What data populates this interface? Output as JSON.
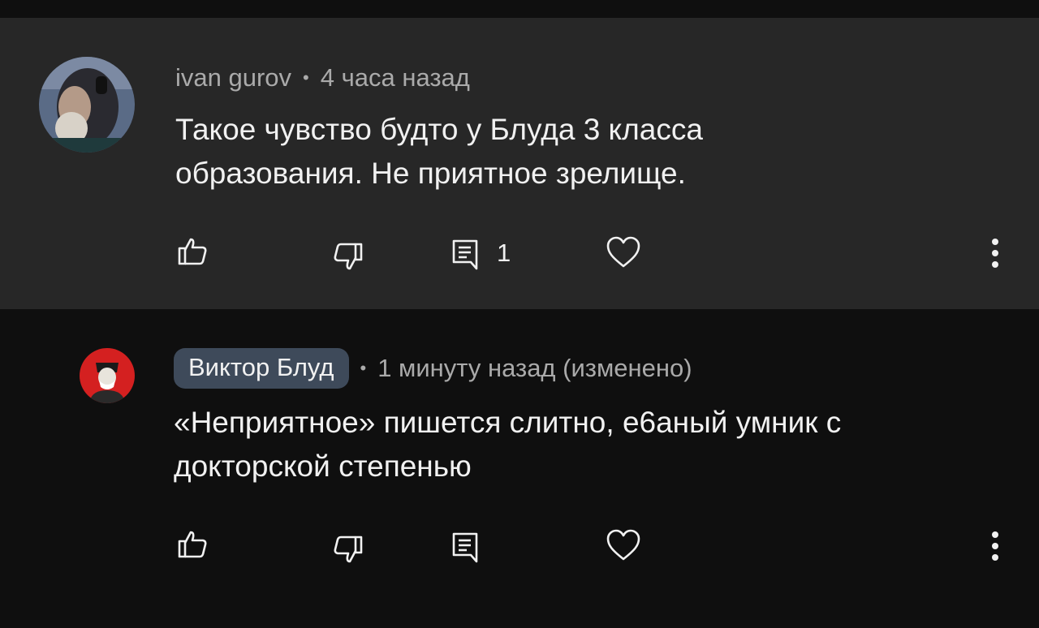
{
  "comments": [
    {
      "author": "ivan gurov",
      "time": "4 часа назад",
      "text_line1": "Такое чувство будто у Блуда 3 класса",
      "text_line2": "образования. Не приятное зрелище.",
      "reply_count": "1"
    },
    {
      "author": "Виктор Блуд",
      "time": "1 минуту назад (изменено)",
      "text_line1": "«Неприятное» пишется слитно, е6аный умник с",
      "text_line2": "докторской степенью"
    }
  ],
  "separator": "•",
  "icons": [
    "like-icon",
    "dislike-icon",
    "reply-icon",
    "heart-icon",
    "more-vertical-icon"
  ],
  "colors": {
    "background": "#0f0f0f",
    "highlighted_comment": "#272727",
    "author_badge": "#3e4a5a",
    "meta_text": "#aaaaaa",
    "text": "#f1f1f1"
  }
}
